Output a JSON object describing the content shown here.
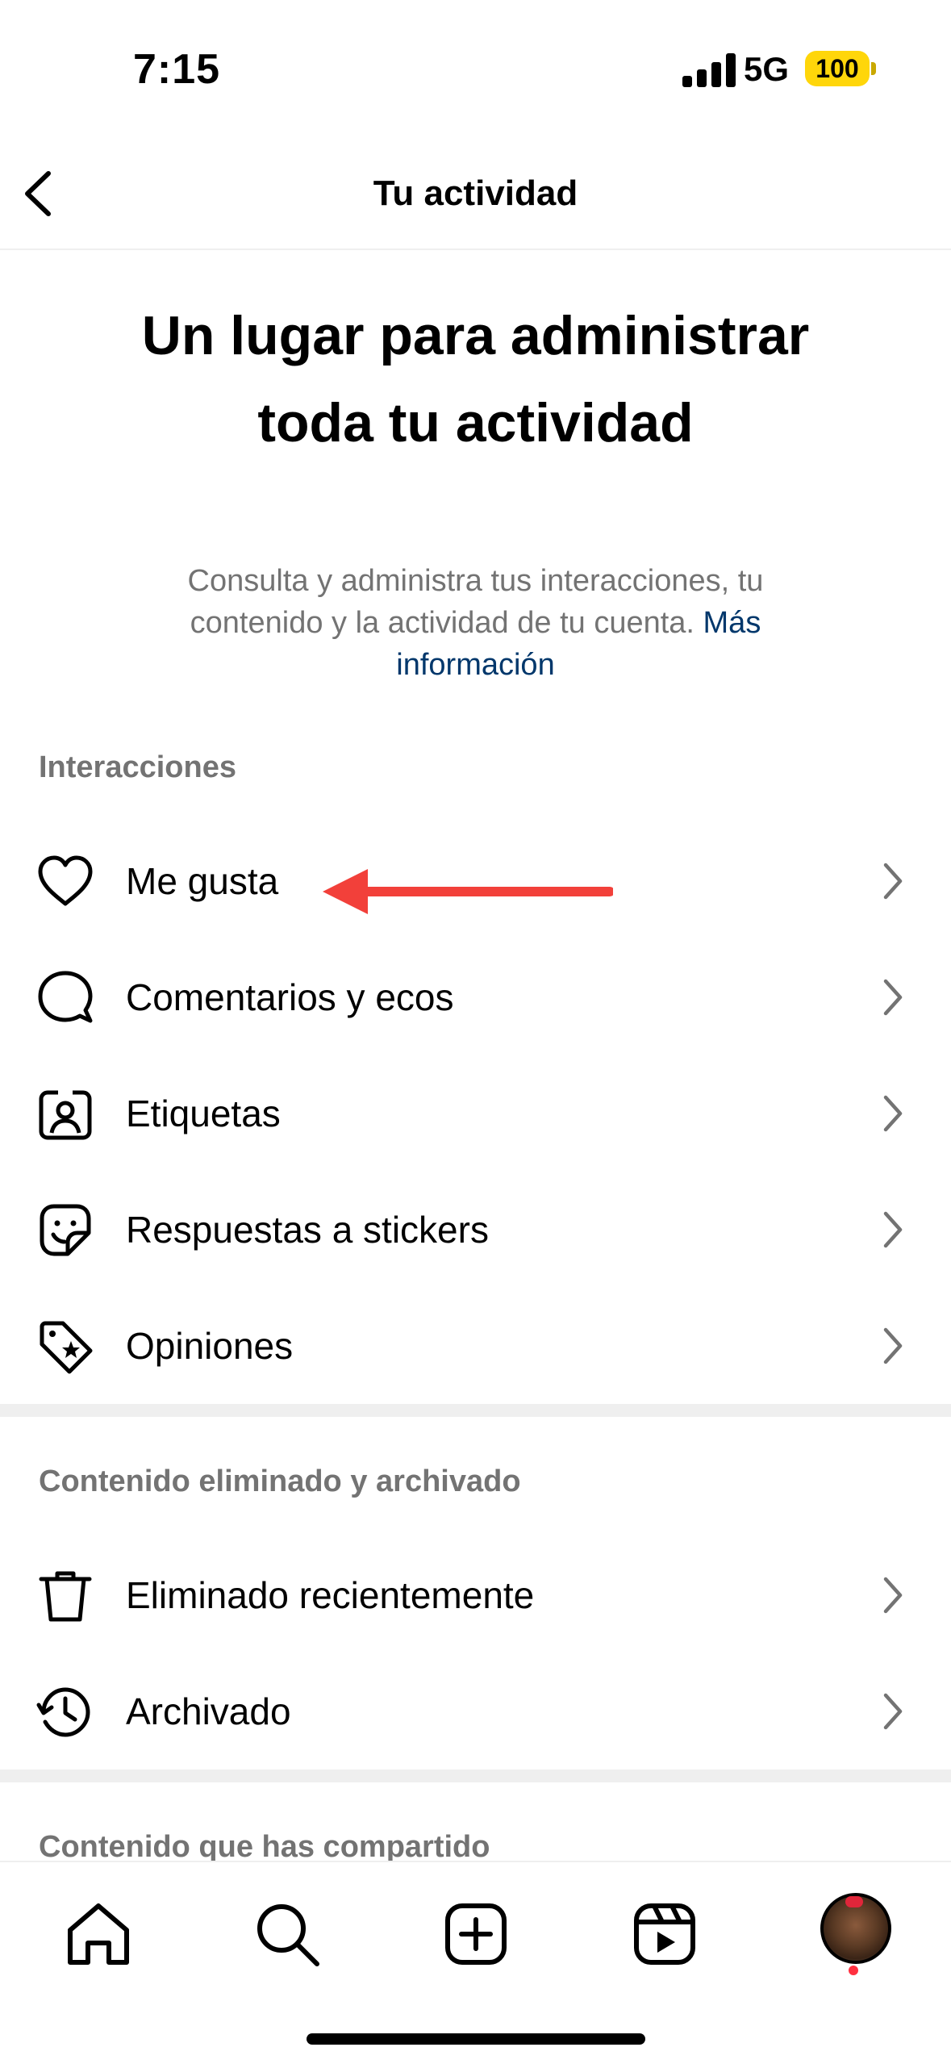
{
  "status_bar": {
    "time": "7:15",
    "network": "5G",
    "battery": "100"
  },
  "header": {
    "title": "Tu actividad"
  },
  "hero": {
    "title": "Un lugar para administrar toda tu actividad",
    "description": "Consulta y administra tus interacciones, tu contenido y la actividad de tu cuenta.",
    "link": "Más información"
  },
  "sections": {
    "interactions": {
      "title": "Interacciones",
      "items": [
        {
          "label": "Me gusta",
          "icon": "heart-icon"
        },
        {
          "label": "Comentarios y ecos",
          "icon": "comment-icon"
        },
        {
          "label": "Etiquetas",
          "icon": "tag-person-icon"
        },
        {
          "label": "Respuestas a stickers",
          "icon": "sticker-icon"
        },
        {
          "label": "Opiniones",
          "icon": "review-tag-icon"
        }
      ]
    },
    "removed": {
      "title": "Contenido eliminado y archivado",
      "items": [
        {
          "label": "Eliminado recientemente",
          "icon": "trash-icon"
        },
        {
          "label": "Archivado",
          "icon": "archive-history-icon"
        }
      ]
    },
    "shared": {
      "title": "Contenido que has compartido"
    }
  },
  "annotation": {
    "color": "#f2403a",
    "target": "Me gusta"
  },
  "tab_bar": {
    "items": [
      "home-icon",
      "search-icon",
      "create-icon",
      "reels-icon",
      "profile-avatar"
    ]
  }
}
